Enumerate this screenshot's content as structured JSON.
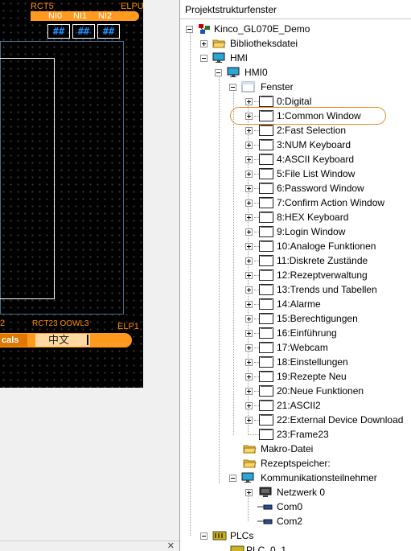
{
  "canvas": {
    "top_labels": {
      "rct": "RCT5",
      "ni0": "NI0",
      "ni1": "NI1",
      "ni2": "NI2",
      "elp": "ELPU"
    },
    "hash_boxes": [
      "##",
      "##",
      "##"
    ],
    "bottom_labels": {
      "left": "2",
      "mid": "RCT23 OOWL3",
      "elp": "ELP1"
    },
    "lang_buttons": [
      "cals",
      "中文"
    ]
  },
  "tree": {
    "header": "Projektstrukturfenster",
    "root": "Kinco_GL070E_Demo",
    "library": "Bibliotheksdatei",
    "hmi": "HMI",
    "hmi0": "HMI0",
    "fenster": "Fenster",
    "windows": [
      "0:Digital",
      "1:Common Window",
      "2:Fast Selection",
      "3:NUM Keyboard",
      "4:ASCII Keyboard",
      "5:File List Window",
      "6:Password Window",
      "7:Confirm Action Window",
      "8:HEX Keyboard",
      "9:Login Window",
      "10:Analoge Funktionen",
      "11:Diskrete Zustände",
      "12:Rezeptverwaltung",
      "13:Trends und Tabellen",
      "14:Alarme",
      "15:Berechtigungen",
      "16:Einführung",
      "17:Webcam",
      "18:Einstellungen",
      "19:Rezepte Neu",
      "20:Neue Funktionen",
      "21:ASCII2",
      "22:External Device Download",
      "23:Frame23"
    ],
    "macro": "Makro-Datei",
    "recipe": "Rezeptspeicher:",
    "comm": "Kommunikationsteilnehmer",
    "network": "Netzwerk 0",
    "com0": "Com0",
    "com2": "Com2",
    "plcs": "PLCs",
    "plc01": "PLC_0_1",
    "highlighted_item": "1:Common Window",
    "highlight_color": "#f08a2c"
  }
}
